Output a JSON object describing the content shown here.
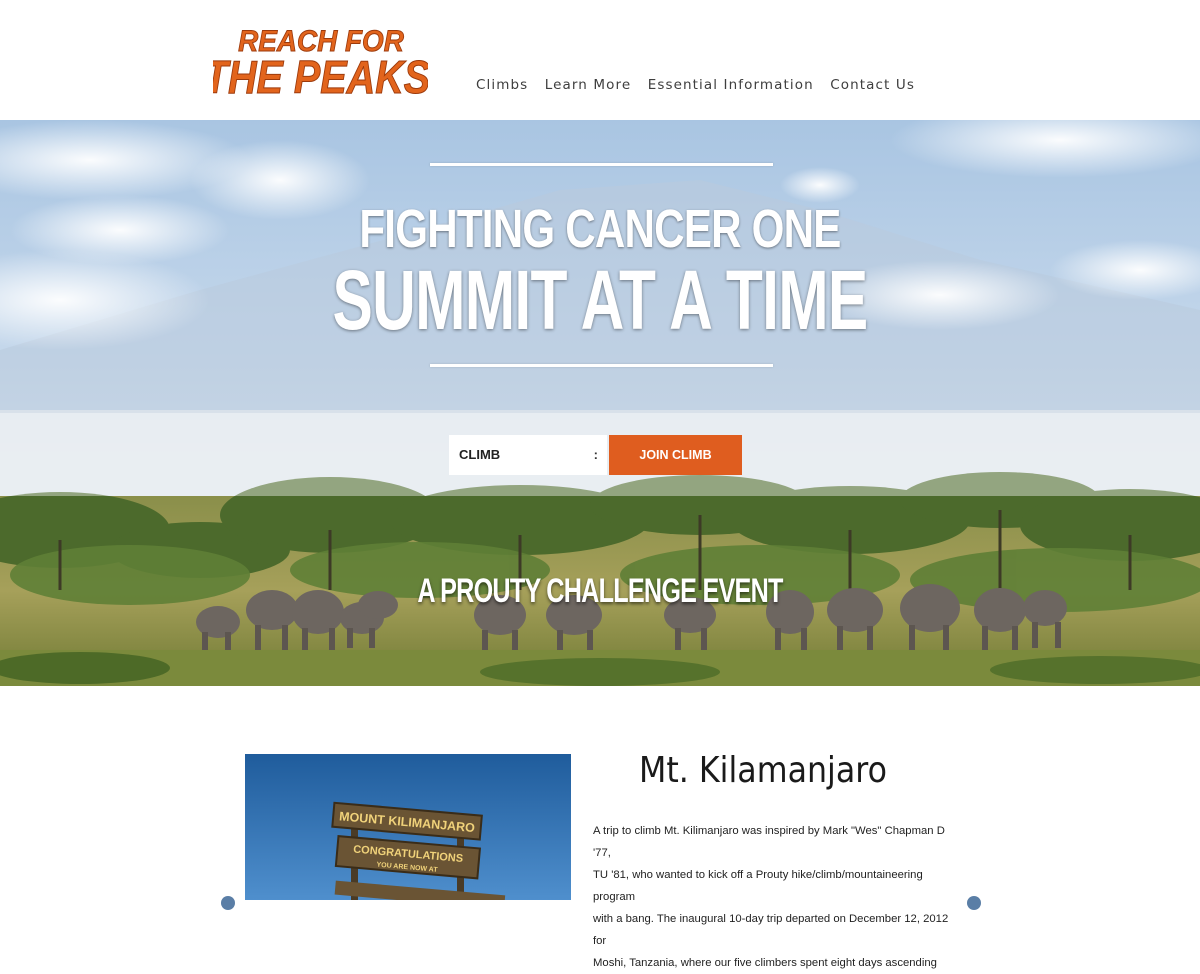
{
  "brand": {
    "logo_line1": "REACH FOR",
    "logo_line2": "THE PEAKS",
    "logo_color": "#e2641c"
  },
  "nav": {
    "items": [
      "Climbs",
      "Learn More",
      "Essential Information",
      "Contact Us"
    ]
  },
  "hero": {
    "headline_line1": "FIGHTING CANCER ONE",
    "headline_line2": "SUMMIT AT A TIME",
    "climb_select_value": "CLIMB",
    "select_arrow": ":",
    "join_button_label": "JOIN CLIMB",
    "tagline": "A PROUTY CHALLENGE EVENT",
    "accent_color": "#df5d1f"
  },
  "feature": {
    "title": "Mt. Kilamanjaro",
    "sign_line1": "MOUNT KILIMANJARO",
    "sign_line2": "CONGRATULATIONS",
    "sign_line3": "YOU ARE NOW AT",
    "body_lines": [
      "A trip to climb Mt. Kilimanjaro was inspired by Mark \"Wes\" Chapman D '77,",
      "TU '81, who wanted to kick off a Prouty hike/climb/mountaineering program",
      "with a bang. The inaugural 10-day trip departed on December 12, 2012 for",
      "Moshi, Tanzania, where our five climbers spent eight days ascending"
    ]
  }
}
